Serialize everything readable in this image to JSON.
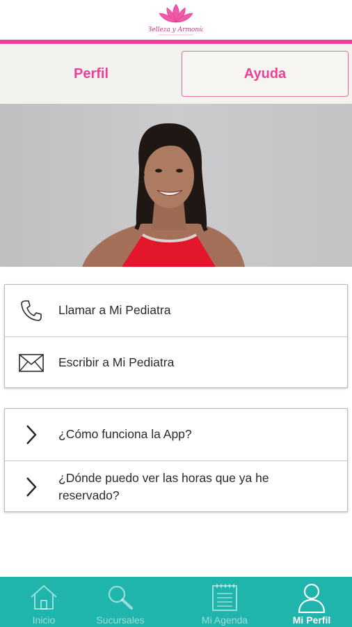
{
  "app": {
    "brand_name": "Belleza y Armonía",
    "brand_color": "#ee3e97",
    "accent_color": "#1fb5ac"
  },
  "tabs": [
    {
      "label": "Perfil",
      "selected": false
    },
    {
      "label": "Ayuda",
      "selected": true
    }
  ],
  "profile_photo": {
    "icon": "profile-photo"
  },
  "contact": [
    {
      "label": "Llamar a Mi Pediatra",
      "icon": "phone-icon"
    },
    {
      "label": "Escribir a Mi Pediatra",
      "icon": "mail-icon"
    }
  ],
  "faq": [
    {
      "label": "¿Cómo funciona la App?",
      "icon": "chevron-right-icon"
    },
    {
      "label": "¿Dónde puedo ver las horas que ya he reservado?",
      "icon": "chevron-right-icon"
    }
  ],
  "bottom_nav": [
    {
      "label": "Inicio",
      "icon": "home-icon",
      "active": false
    },
    {
      "label": "Sucursales",
      "icon": "search-icon",
      "active": false
    },
    {
      "label": "Mi Agenda",
      "icon": "notepad-icon",
      "active": false
    },
    {
      "label": "Mi Perfil",
      "icon": "user-icon",
      "active": true
    }
  ]
}
